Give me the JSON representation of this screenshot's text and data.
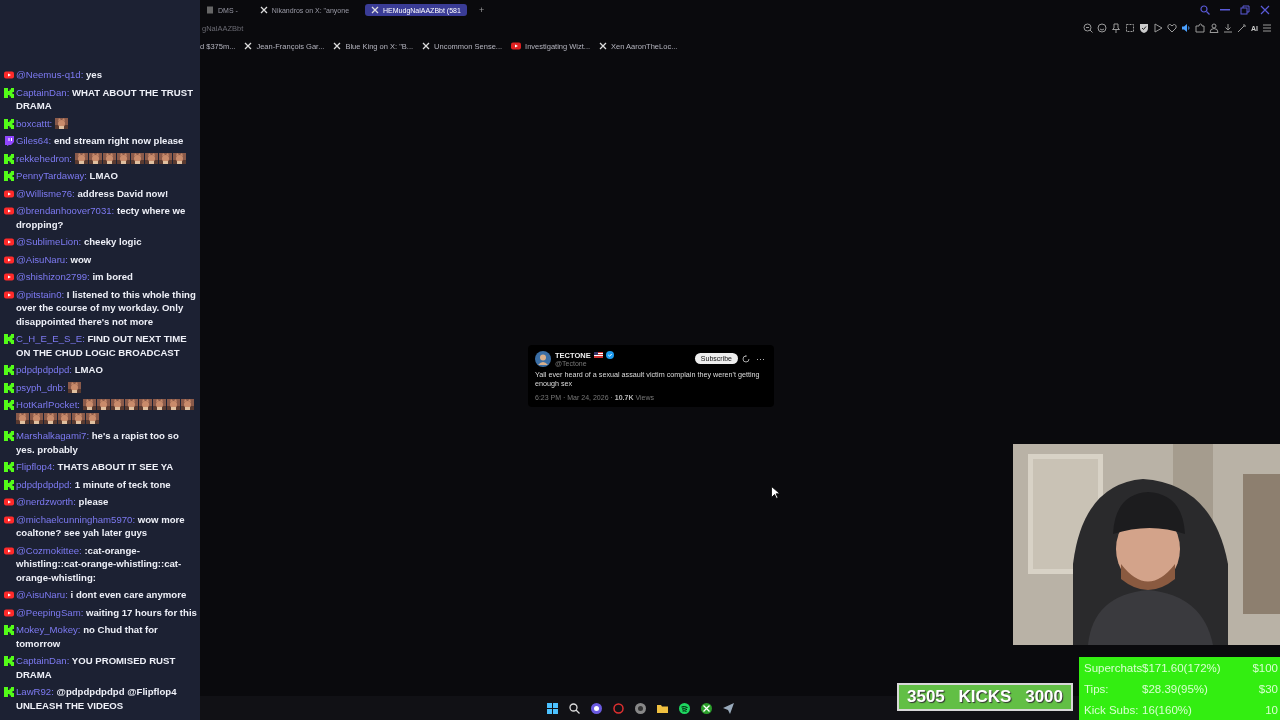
{
  "chat": {
    "messages": [
      {
        "kind": "youtube",
        "user": "@Neemus-q1d:",
        "text": "yes"
      },
      {
        "kind": "kick",
        "user": "CaptainDan:",
        "text": "WHAT ABOUT THE TRUST DRAMA"
      },
      {
        "kind": "kick",
        "user": "boxcattt:"
      },
      {
        "kind": "twitch",
        "user": "Giles64:",
        "text": "end stream right now please"
      },
      {
        "kind": "kick",
        "user": "rekkehedron:"
      },
      {
        "kind": "kick",
        "user": "PennyTardaway:",
        "text": "LMAO"
      },
      {
        "kind": "youtube",
        "user": "@Willisme76:",
        "text": "address David now!"
      },
      {
        "kind": "youtube",
        "user": "@brendanhoover7031:",
        "text": "tecty where we dropping?"
      },
      {
        "kind": "youtube",
        "user": "@SublimeLion:",
        "text": "cheeky logic"
      },
      {
        "kind": "youtube",
        "user": "@AisuNaru:",
        "text": "wow"
      },
      {
        "kind": "youtube",
        "user": "@shishizon2799:",
        "text": "im bored"
      },
      {
        "kind": "youtube",
        "user": "@pitstain0:",
        "text": "I listened to this whole thing over the course of my workday. Only disappointed there's not more"
      },
      {
        "kind": "kick",
        "user": "C_H_E_E_S_E:",
        "text": "FIND OUT NEXT TIME ON THE CHUD LOGIC BROADCAST"
      },
      {
        "kind": "kick",
        "user": "pdpdpdpdpd:",
        "text": "LMAO"
      },
      {
        "kind": "kick",
        "user": "psyph_dnb:"
      },
      {
        "kind": "kick",
        "user": "HotKarlPocket:"
      },
      {
        "kind": "kick",
        "user": "Marshalkagami7:",
        "text": "he's a rapist too so yes. probably"
      },
      {
        "kind": "kick",
        "user": "Flipflop4:",
        "text": "THATS ABOUT IT SEE YA"
      },
      {
        "kind": "kick",
        "user": "pdpdpdpdpd:",
        "text": "1 minute of teck tone"
      },
      {
        "kind": "youtube",
        "user": "@nerdzworth:",
        "text": "please"
      },
      {
        "kind": "youtube",
        "user": "@michaelcunningham5970:",
        "text": "wow more coaltone? see yah later guys"
      },
      {
        "kind": "youtube",
        "user": "@Cozmokittee:",
        "text": ":cat-orange-whistling::cat-orange-whistling::cat-orange-whistling:"
      },
      {
        "kind": "youtube",
        "user": "@AisuNaru:",
        "text": "i dont even care anymore"
      },
      {
        "kind": "youtube",
        "user": "@PeepingSam:",
        "text": "waiting 17 hours for this"
      },
      {
        "kind": "kick",
        "user": "Mokey_Mokey:",
        "text": "no Chud that for tomorrow"
      },
      {
        "kind": "kick",
        "user": "CaptainDan:",
        "text": "YOU PROMISED RUST DRAMA"
      },
      {
        "kind": "kick",
        "user": "LawR92:",
        "text": "@pdpdpdpdpd @Flipflop4 UNLEASH THE VIDEOS"
      }
    ]
  },
  "browser": {
    "tabs": [
      {
        "label": "DMS -",
        "kind": "page",
        "selected": false
      },
      {
        "label": "Nikandros on X: \"anyone",
        "kind": "x",
        "selected": false
      },
      {
        "label": "HEMudgNalAAZBbt (581",
        "kind": "x",
        "selected": true
      }
    ],
    "new_tab": "+",
    "address": "gNalAAZBbt",
    "toolbar_label": "AI",
    "bookmarks": [
      {
        "label": "d $375m...",
        "kind": "plain"
      },
      {
        "label": "Jean-François Gar...",
        "kind": "x"
      },
      {
        "label": "Blue King on X: \"B...",
        "kind": "x"
      },
      {
        "label": "Uncommon Sense...",
        "kind": "x"
      },
      {
        "label": "Investigating Wizt...",
        "kind": "youtube"
      },
      {
        "label": "Xen AaronTheLoc...",
        "kind": "x"
      }
    ]
  },
  "tweet": {
    "name": "TECTONE",
    "handle": "@Tectone",
    "button": "Subscribe",
    "more": "···",
    "text": "Yall ever heard of a sexual assault victim complain they weren't getting enough sex",
    "meta": "6:23 PM · Mar 24, 2026 · **10.7K** Views"
  },
  "kicks_goal": {
    "current": "3505",
    "label": "KICKS",
    "goal": "3000"
  },
  "goals": [
    {
      "label": "Superchats",
      "amount": "$171.60(172%)",
      "target": "$100"
    },
    {
      "label": "Tips:",
      "amount": "$28.39(95%)",
      "target": "$30"
    },
    {
      "label": "Kick Subs:",
      "amount": "16(160%)",
      "target": "10"
    }
  ]
}
